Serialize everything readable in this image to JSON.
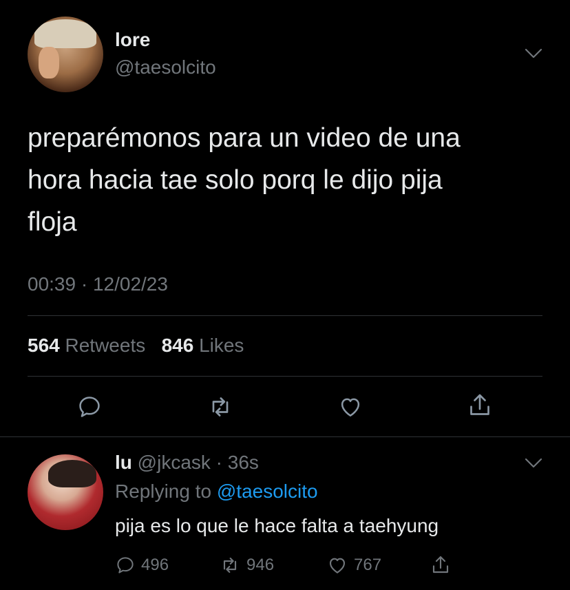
{
  "main_tweet": {
    "name": "lore",
    "handle": "@taesolcito",
    "text": "preparémonos para un video de una\nhora hacia tae solo porq le dijo pija\nfloja",
    "timestamp": "00:39 · 12/02/23",
    "stats": {
      "retweets_count": "564",
      "retweets_label": "Retweets",
      "likes_count": "846",
      "likes_label": "Likes"
    }
  },
  "reply_tweet": {
    "name": "lu",
    "handle_time": "@jkcask · 36s",
    "replying_prefix": "Replying to",
    "replying_mention": "@taesolcito",
    "text": "pija es lo que le hace falta a taehyung",
    "actions": {
      "replies": "496",
      "retweets": "946",
      "likes": "767"
    }
  },
  "icons": {
    "reply": "reply-icon",
    "retweet": "retweet-icon",
    "like": "heart-icon",
    "share": "share-icon",
    "more": "chevron-down-icon"
  },
  "colors": {
    "background": "#000000",
    "text_primary": "#e7e9ea",
    "text_secondary": "#71767b",
    "accent": "#1d9bf0",
    "divider": "#2f3336"
  }
}
